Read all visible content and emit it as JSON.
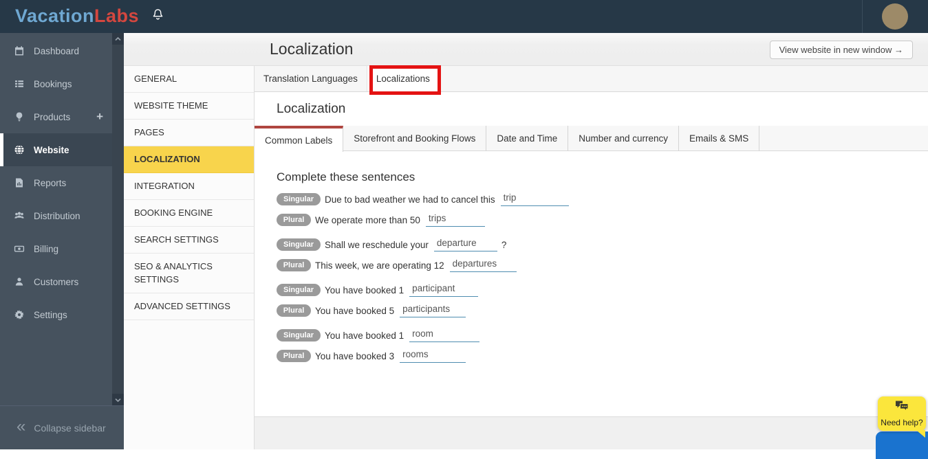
{
  "brand": {
    "part1": "Vacation",
    "part2": "Labs"
  },
  "sidebar": {
    "items": [
      {
        "label": "Dashboard"
      },
      {
        "label": "Bookings"
      },
      {
        "label": "Products",
        "add": "+"
      },
      {
        "label": "Website"
      },
      {
        "label": "Reports"
      },
      {
        "label": "Distribution"
      },
      {
        "label": "Billing"
      },
      {
        "label": "Customers"
      },
      {
        "label": "Settings"
      }
    ],
    "collapse_icon": "«",
    "collapse_label": "Collapse sidebar"
  },
  "header": {
    "title": "Localization",
    "view_website_button": "View website in new window →"
  },
  "settings_menu": {
    "items": [
      {
        "label": "GENERAL"
      },
      {
        "label": "WEBSITE THEME"
      },
      {
        "label": "PAGES"
      },
      {
        "label": "LOCALIZATION"
      },
      {
        "label": "INTEGRATION"
      },
      {
        "label": "BOOKING ENGINE"
      },
      {
        "label": "SEARCH SETTINGS"
      },
      {
        "label": "SEO & ANALYTICS SETTINGS"
      },
      {
        "label": "ADVANCED SETTINGS"
      }
    ]
  },
  "page_tabs": {
    "items": [
      {
        "label": "Translation Languages"
      },
      {
        "label": "Localizations"
      }
    ]
  },
  "panel": {
    "title": "Localization",
    "tabs": [
      {
        "label": "Common Labels"
      },
      {
        "label": "Storefront and Booking Flows"
      },
      {
        "label": "Date and Time"
      },
      {
        "label": "Number and currency"
      },
      {
        "label": "Emails & SMS"
      }
    ],
    "section_title": "Complete these sentences",
    "rows": [
      {
        "badge": "Singular",
        "text": "Due to bad weather we had to cancel this",
        "value": "trip"
      },
      {
        "badge": "Plural",
        "text": "We operate more than 50",
        "value": "trips"
      },
      {
        "badge": "Singular",
        "text": "Shall we reschedule your",
        "value": "departure",
        "suffix": "?"
      },
      {
        "badge": "Plural",
        "text": "This week, we are operating 12",
        "value": "departures"
      },
      {
        "badge": "Singular",
        "text": "You have booked 1",
        "value": "participant"
      },
      {
        "badge": "Plural",
        "text": "You have booked 5",
        "value": "participants"
      },
      {
        "badge": "Singular",
        "text": "You have booked 1",
        "value": "room"
      },
      {
        "badge": "Plural",
        "text": "You have booked 3",
        "value": "rooms"
      }
    ]
  },
  "help_widget": {
    "label": "Need help?"
  },
  "colors": {
    "brand_blue": "#6FA8D2",
    "brand_red": "#D4473F",
    "navbar": "#263847",
    "sidebar": "#46525E",
    "accent_yellow": "#F8D44C",
    "annotation_red": "#E41313",
    "tab_active_red": "#AF4540",
    "underline_blue": "#4E8CB0",
    "help_yellow": "#FBE63C",
    "primary_blue": "#1A73CF"
  }
}
